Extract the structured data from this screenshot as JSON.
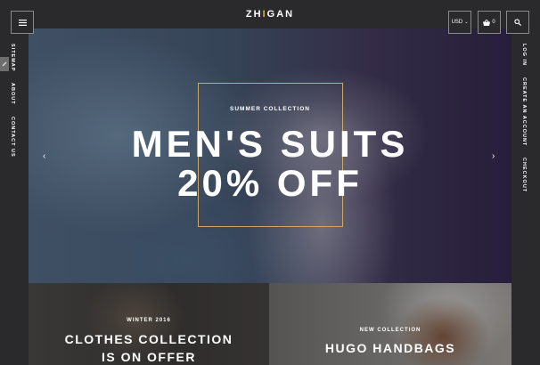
{
  "header": {
    "logo_left": "ZH",
    "logo_sep": "I",
    "logo_right": "GAN",
    "currency": "USD",
    "cart_count": "0",
    "menu_icon": "hamburger-icon",
    "search_icon": "search-icon",
    "cart_icon": "basket-icon"
  },
  "side_left": {
    "links": [
      "SITEMAP",
      "ABOUT",
      "CONTACT US"
    ]
  },
  "side_right": {
    "links": [
      "LOG IN",
      "CREATE AN ACCOUNT",
      "CHECKOUT"
    ]
  },
  "hero": {
    "subtitle": "SUMMER COLLECTION",
    "title_line1": "MEN'S SUITS",
    "title_line2": "20% OFF",
    "prev_arrow": "‹",
    "next_arrow": "›"
  },
  "promos": [
    {
      "subtitle": "WINTER 2016",
      "title_line1": "CLOTHES COLLECTION",
      "title_line2": "IS ON OFFER"
    },
    {
      "subtitle": "NEW COLLECTION",
      "title_line1": "HUGO HANDBAGS"
    }
  ],
  "colors": {
    "background": "#2a2a2c",
    "accent": "#d4a94e",
    "frame": "#c9a868",
    "text": "#ffffff"
  }
}
